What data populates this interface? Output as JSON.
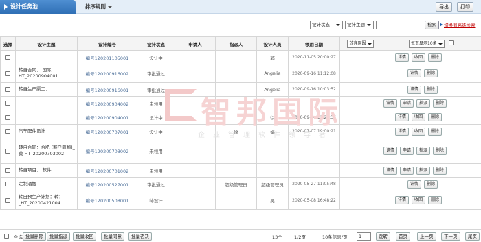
{
  "header": {
    "title": "设计任务池",
    "sort_label": "排序规则",
    "export_label": "导出",
    "print_label": "打印"
  },
  "filters": {
    "status_select": "设计状态",
    "theme_select": "设计主题",
    "search_value": "",
    "search_button": "检索",
    "advanced_link": "切换到高级检索"
  },
  "table": {
    "columns": {
      "select": "选择",
      "theme": "设计主题",
      "code": "设计编号",
      "status": "设计状态",
      "applicant": "申请人",
      "assignor": "指派人",
      "designer": "设计人员",
      "claim_date": "领用日期",
      "abandon_reason": "放弃原因",
      "page_size": "每页显示10条"
    },
    "rows": [
      {
        "theme": "",
        "code": "编号120201105001",
        "status": "设计中",
        "applicant": "",
        "assignor": "",
        "designer": "郭",
        "date": "2020-11-05 20:00:27",
        "ops": [
          "详情",
          "收回",
          "删除"
        ]
      },
      {
        "theme": "转自合同：      国际HT_20200904001",
        "code": "编号120200916002",
        "status": "审批通过",
        "applicant": "",
        "assignor": "",
        "designer": "Angelia",
        "date": "2020-09-16 11:12:08",
        "ops": [
          "详情",
          "删除"
        ]
      },
      {
        "theme": "转自生产渠工：",
        "code": "编号120200916001",
        "status": "审批通过",
        "applicant": "",
        "assignor": "",
        "designer": "Angelia",
        "date": "2020-09-16 10:03:52",
        "ops": [
          "详情",
          "删除"
        ]
      },
      {
        "theme": "",
        "code": "编号120200904002",
        "status": "未领用",
        "applicant": "",
        "assignor": "",
        "designer": "",
        "date": "",
        "ops": [
          "详情",
          "申请",
          "指派",
          "删除"
        ]
      },
      {
        "theme": "",
        "code": "编号120200904001",
        "status": "设计中",
        "applicant": "",
        "assignor": "",
        "designer": "徐",
        "date": "2020-09-04 12:27:37",
        "ops": [
          "详情",
          "收回",
          "删除"
        ]
      },
      {
        "theme": "汽车配件设计",
        "code": "编号120200707001",
        "status": "设计中",
        "applicant": "",
        "assignor": "徐",
        "designer": "娟",
        "date": "2020-07-07 19:00:21",
        "ops": [
          "详情",
          "收回",
          "删除"
        ]
      },
      {
        "theme": "转自合同：合肥      (客户简称)_黄      HT_20200703002",
        "code": "编号120200703002",
        "status": "未领用",
        "applicant": "",
        "assignor": "",
        "designer": "",
        "date": "",
        "ops": [
          "详情",
          "申请",
          "指派",
          "删除"
        ]
      },
      {
        "theme": "转自项目：      软件",
        "code": "编号120200701002",
        "status": "未领用",
        "applicant": "",
        "assignor": "",
        "designer": "",
        "date": "",
        "ops": [
          "详情",
          "申请",
          "指派",
          "删除"
        ]
      },
      {
        "theme": "      定制酒瓶",
        "code": "编号120200527001",
        "status": "审批通过",
        "applicant": "",
        "assignor": "超级管理员",
        "designer": "超级管理员",
        "date": "2020-05-27 11:05:48",
        "ops": [
          "详情",
          "删除"
        ]
      },
      {
        "theme": "转自预生产计划：转：_HT_20200421004",
        "code": "编号120200508001",
        "status": "待设计",
        "applicant": "",
        "assignor": "",
        "designer": "吴",
        "date": "2020-05-08 16:48:22",
        "ops": [
          "详情",
          "收回",
          "删除"
        ]
      }
    ]
  },
  "footer": {
    "select_all": "全选",
    "batch_delete": "批量删除",
    "batch_assign": "批量指派",
    "batch_recall": "批量收回",
    "batch_approve": "批量同意",
    "batch_reject": "批量否决",
    "record_count": "13个",
    "page_info": "1/2页",
    "per_page": "10条信息/页",
    "page_input": "1",
    "jump": "跳转",
    "first": "首页",
    "prev": "上一页",
    "next": "下一页",
    "last": "尾页"
  },
  "watermark": {
    "name": "智邦国际",
    "tagline": "企业管理软件领导者"
  }
}
